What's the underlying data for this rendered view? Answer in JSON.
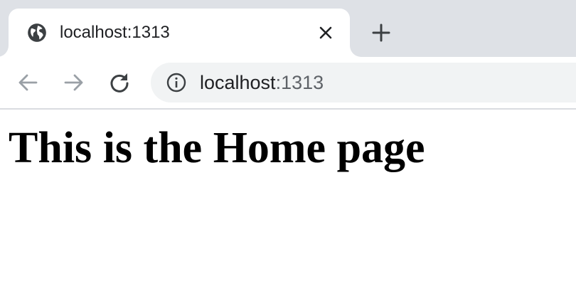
{
  "tab": {
    "title": "localhost:1313",
    "favicon": "globe-icon",
    "close_icon": "close-icon"
  },
  "new_tab": {
    "icon": "plus-icon"
  },
  "toolbar": {
    "back_icon": "arrow-left-icon",
    "forward_icon": "arrow-right-icon",
    "reload_icon": "reload-icon"
  },
  "omnibox": {
    "info_icon": "info-icon",
    "url_host": "localhost",
    "url_port": ":1313"
  },
  "page": {
    "heading": "This is the Home page"
  },
  "colors": {
    "tabstrip_bg": "#dee1e6",
    "omnibox_bg": "#f1f3f4",
    "icon_dark": "#3c4043",
    "icon_disabled": "#9aa0a6"
  }
}
